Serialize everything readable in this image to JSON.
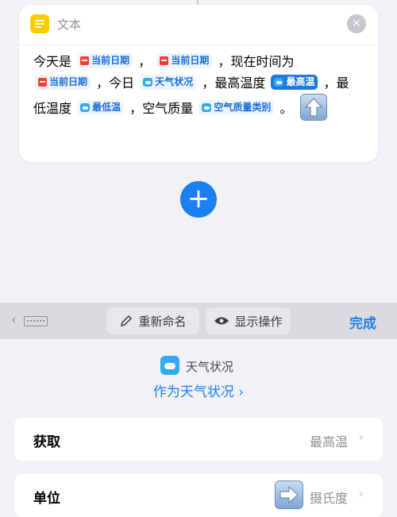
{
  "card": {
    "title": "文本",
    "icon": "text-doc-icon",
    "accent": "#ffcc00",
    "body": {
      "t1": "今天是",
      "token_date1": "当前日期",
      "t2": "，",
      "token_date2": "当前日期",
      "t3": "，现在时间为",
      "token_date3": "当前日期",
      "t4": "，今日",
      "token_weather": "天气状况",
      "t5": "，最高温度",
      "token_high": "最高温",
      "t6": "，最",
      "t7": "低温度",
      "token_low": "最低温",
      "t8": "，空气质量",
      "token_aqi": "空气质量类别",
      "t9": "。"
    }
  },
  "toolbar": {
    "rename_label": "重新命名",
    "show_actions_label": "显示操作",
    "done_label": "完成"
  },
  "action": {
    "name": "天气状况",
    "sub_label": "作为天气状况 ›"
  },
  "rows": [
    {
      "label": "获取",
      "value": "最高温",
      "chevron": "›"
    },
    {
      "label": "单位",
      "value": "摄氏度",
      "chevron": "›"
    }
  ],
  "colors": {
    "accent_blue": "#1a7ff0",
    "background": "#f2f2f6",
    "token_bg": "#eef4fb"
  }
}
